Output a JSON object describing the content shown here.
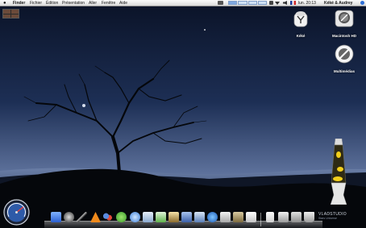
{
  "menubar": {
    "apple": "",
    "items": [
      "Finder",
      "Fichier",
      "Édition",
      "Présentation",
      "Aller",
      "Fenêtre",
      "Aide"
    ],
    "clock": "lun. 20:13",
    "user": "Kéké & Audrey"
  },
  "desktop": {
    "icons": [
      {
        "label": "Kéké",
        "icon": "user-home-icon"
      },
      {
        "label": "Macintosh HD",
        "icon": "hard-drive-icon"
      },
      {
        "label": "Multimédias",
        "icon": "disc-icon"
      }
    ]
  },
  "watermark": {
    "title": "VLADSTUDIO",
    "subtitle": "Stars Universe"
  },
  "colors": {
    "sky_top": "#0a1226",
    "sky_horizon": "#7a8eb4",
    "hill": "#05070b",
    "menubar": "#e9e9e9"
  }
}
